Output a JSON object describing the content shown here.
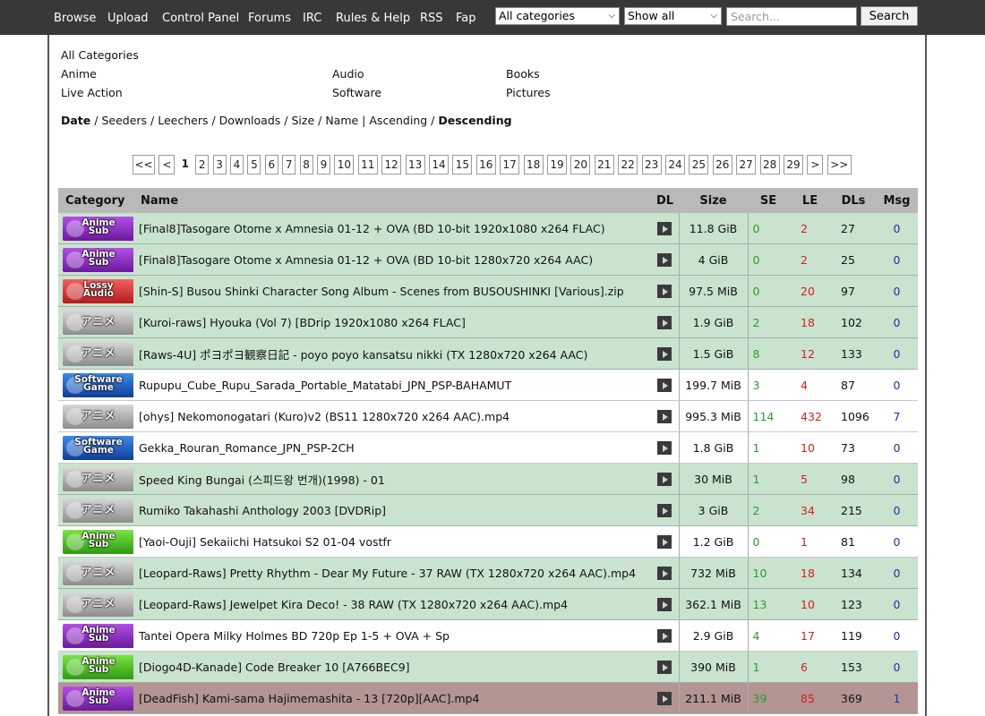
{
  "nav": [
    "Browse",
    "Upload",
    "Control Panel",
    "Forums",
    "IRC",
    "Rules & Help",
    "RSS",
    "Fap"
  ],
  "filters": {
    "category": "All categories",
    "show": "Show all",
    "search_placeholder": "Search...",
    "search_button": "Search"
  },
  "categories": {
    "all": "All Categories",
    "anime": "Anime",
    "audio": "Audio",
    "books": "Books",
    "live_action": "Live Action",
    "software": "Software",
    "pictures": "Pictures"
  },
  "sort": {
    "date": "Date",
    "seeders": "Seeders",
    "leechers": "Leechers",
    "downloads": "Downloads",
    "size": "Size",
    "name": "Name",
    "ascending": "Ascending",
    "descending": "Descending",
    "sep_slash": " / ",
    "sep_bar": " | "
  },
  "pager": {
    "first": "<<",
    "prev": "<",
    "current": "1",
    "pages": [
      "2",
      "3",
      "4",
      "5",
      "6",
      "7",
      "8",
      "9",
      "10",
      "11",
      "12",
      "13",
      "14",
      "15",
      "16",
      "17",
      "18",
      "19",
      "20",
      "21",
      "22",
      "23",
      "24",
      "25",
      "26",
      "27",
      "28",
      "29"
    ],
    "next": ">",
    "last": ">>"
  },
  "table": {
    "headers": {
      "category": "Category",
      "name": "Name",
      "dl": "DL",
      "size": "Size",
      "se": "SE",
      "le": "LE",
      "dls": "DLs",
      "msg": "Msg"
    },
    "rows": [
      {
        "badge": "animesub",
        "badge_text": "Anime\nSub",
        "status": "green",
        "name": "[Final8]Tasogare Otome x Amnesia 01-12 + OVA (BD 10-bit 1920x1080 x264 FLAC)",
        "size": "11.8 GiB",
        "se": "0",
        "le": "2",
        "dls": "27",
        "msg": "0"
      },
      {
        "badge": "animesub",
        "badge_text": "Anime\nSub",
        "status": "green",
        "name": "[Final8]Tasogare Otome x Amnesia 01-12 + OVA (BD 10-bit 1280x720 x264 AAC)",
        "size": "4 GiB",
        "se": "0",
        "le": "2",
        "dls": "25",
        "msg": "0"
      },
      {
        "badge": "lossy",
        "badge_text": "Lossy\nAudio",
        "status": "green",
        "name": "[Shin-S] Busou Shinki Character Song Album - Scenes from BUSOUSHINKI [Various].zip",
        "size": "97.5 MiB",
        "se": "0",
        "le": "20",
        "dls": "97",
        "msg": "0"
      },
      {
        "badge": "anime",
        "badge_text": "アニメ",
        "status": "green",
        "name": "[Kuroi-raws] Hyouka (Vol 7) [BDrip 1920x1080 x264 FLAC]",
        "size": "1.9 GiB",
        "se": "2",
        "le": "18",
        "dls": "102",
        "msg": "0"
      },
      {
        "badge": "anime",
        "badge_text": "アニメ",
        "status": "green",
        "name": "[Raws-4U] ポヨポヨ観察日記 - poyo poyo kansatsu nikki (TX 1280x720 x264 AAC)",
        "size": "1.5 GiB",
        "se": "8",
        "le": "12",
        "dls": "133",
        "msg": "0"
      },
      {
        "badge": "software",
        "badge_text": "Software\nGame",
        "status": "white",
        "name": "Rupupu_Cube_Rupu_Sarada_Portable_Matatabi_JPN_PSP-BAHAMUT",
        "size": "199.7 MiB",
        "se": "3",
        "le": "4",
        "dls": "87",
        "msg": "0"
      },
      {
        "badge": "anime",
        "badge_text": "アニメ",
        "status": "white",
        "name": "[ohys] Nekomonogatari (Kuro)v2 (BS11 1280x720 x264 AAC).mp4",
        "size": "995.3 MiB",
        "se": "114",
        "le": "432",
        "dls": "1096",
        "msg": "7"
      },
      {
        "badge": "software",
        "badge_text": "Software\nGame",
        "status": "white",
        "name": "Gekka_Rouran_Romance_JPN_PSP-2CH",
        "size": "1.8 GiB",
        "se": "1",
        "le": "10",
        "dls": "73",
        "msg": "0"
      },
      {
        "badge": "anime",
        "badge_text": "アニメ",
        "status": "green",
        "name": "Speed King Bungai (스피드왕 번개)(1998) - 01",
        "size": "30 MiB",
        "se": "1",
        "le": "5",
        "dls": "98",
        "msg": "0"
      },
      {
        "badge": "anime",
        "badge_text": "アニメ",
        "status": "green",
        "name": "Rumiko Takahashi Anthology 2003 [DVDRip]",
        "size": "3 GiB",
        "se": "2",
        "le": "34",
        "dls": "215",
        "msg": "0"
      },
      {
        "badge": "green",
        "badge_text": "Anime\nSub",
        "status": "white",
        "name": "[Yaoi-Ouji] Sekaiichi Hatsukoi S2 01-04 vostfr",
        "size": "1.2 GiB",
        "se": "0",
        "le": "1",
        "dls": "81",
        "msg": "0"
      },
      {
        "badge": "anime",
        "badge_text": "アニメ",
        "status": "green",
        "name": "[Leopard-Raws] Pretty Rhythm - Dear My Future - 37 RAW (TX 1280x720 x264 AAC).mp4",
        "size": "732 MiB",
        "se": "10",
        "le": "18",
        "dls": "134",
        "msg": "0"
      },
      {
        "badge": "anime",
        "badge_text": "アニメ",
        "status": "green",
        "name": "[Leopard-Raws] Jewelpet Kira Deco! - 38 RAW (TX 1280x720 x264 AAC).mp4",
        "size": "362.1 MiB",
        "se": "13",
        "le": "10",
        "dls": "123",
        "msg": "0"
      },
      {
        "badge": "animesub",
        "badge_text": "Anime\nSub",
        "status": "white",
        "name": "Tantei Opera Milky Holmes BD 720p Ep 1-5 + OVA + Sp",
        "size": "2.9 GiB",
        "se": "4",
        "le": "17",
        "dls": "119",
        "msg": "0"
      },
      {
        "badge": "green",
        "badge_text": "Anime\nSub",
        "status": "green",
        "name": "[Diogo4D-Kanade] Code Breaker 10 [A766BEC9]",
        "size": "390 MiB",
        "se": "1",
        "le": "6",
        "dls": "153",
        "msg": "0"
      },
      {
        "badge": "animesub",
        "badge_text": "Anime\nSub",
        "status": "red",
        "name": "[DeadFish] Kami-sama Hajimemashita - 13 [720p][AAC].mp4",
        "size": "211.1 MiB",
        "se": "39",
        "le": "85",
        "dls": "369",
        "msg": "1"
      }
    ]
  }
}
